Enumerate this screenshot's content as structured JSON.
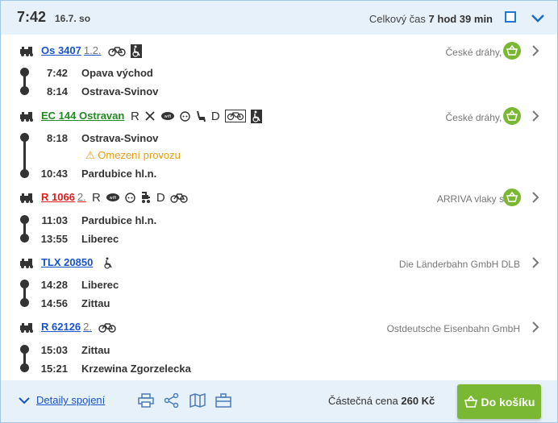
{
  "header": {
    "departure_time": "7:42",
    "date": "16.7. so",
    "total_label": "Celkový čas",
    "total_value": "7 hod 39 min"
  },
  "segments": [
    {
      "train": "Os 3407",
      "class": "1.2.",
      "operator": "České dráhy, a.s.",
      "stops": [
        {
          "time": "7:42",
          "station": "Opava východ"
        },
        {
          "time": "8:14",
          "station": "Ostrava-Svinov"
        }
      ]
    },
    {
      "train": "EC 144 Ostravan",
      "amenity_letters": [
        "R",
        "D"
      ],
      "operator": "České dráhy, a.s.",
      "stops": [
        {
          "time": "8:18",
          "station": "Ostrava-Svinov"
        },
        {
          "time": "10:43",
          "station": "Pardubice hl.n."
        }
      ],
      "warning": "Omezení provozu"
    },
    {
      "train": "R 1066",
      "class": "2.",
      "amenity_letters": [
        "R",
        "D"
      ],
      "operator": "ARRIVA vlaky s.r.o.",
      "stops": [
        {
          "time": "11:03",
          "station": "Pardubice hl.n."
        },
        {
          "time": "13:55",
          "station": "Liberec"
        }
      ]
    },
    {
      "train": "TLX 20850",
      "operator": "Die Länderbahn GmbH DLB",
      "stops": [
        {
          "time": "14:28",
          "station": "Liberec"
        },
        {
          "time": "14:56",
          "station": "Zittau"
        }
      ]
    },
    {
      "train": "R 62126",
      "class": "2.",
      "operator": "Ostdeutsche Eisenbahn GmbH",
      "stops": [
        {
          "time": "15:03",
          "station": "Zittau"
        },
        {
          "time": "15:21",
          "station": "Krzewina Zgorzelecka"
        }
      ]
    }
  ],
  "footer": {
    "details_label": "Detaily spojení",
    "price_label": "Částečná cena",
    "price_value": "260 Kč",
    "cart_button": "Do košíku"
  },
  "colors": {
    "accent_blue": "#1a52c8",
    "basket_green": "#7ab833",
    "warning_orange": "#e89c12",
    "header_bg": "#e6f1fa"
  }
}
